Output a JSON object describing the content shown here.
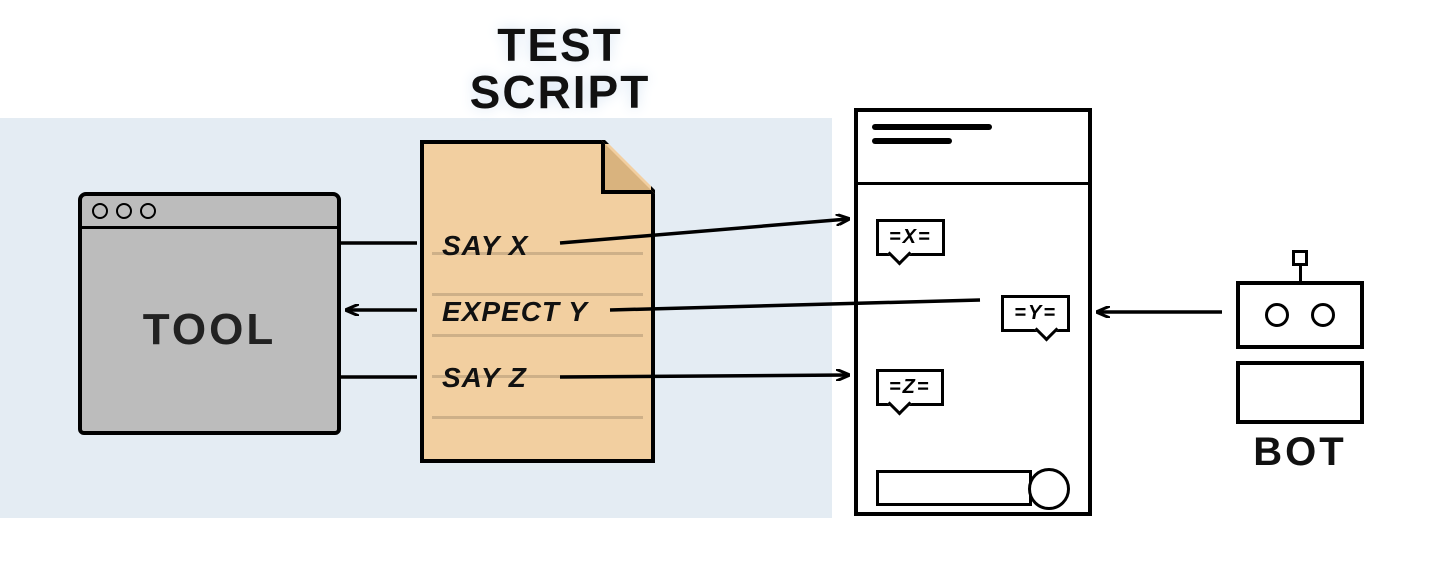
{
  "tool": {
    "label": "TOOL"
  },
  "script": {
    "title_line1": "TEST",
    "title_line2": "SCRIPT",
    "lines": {
      "l1": "SAY X",
      "l2": "EXPECT Y",
      "l3": "SAY Z"
    }
  },
  "chat": {
    "bubbles": {
      "b1": "=X=",
      "b2": "=Y=",
      "b3": "=Z="
    }
  },
  "bot": {
    "label": "BOT"
  }
}
